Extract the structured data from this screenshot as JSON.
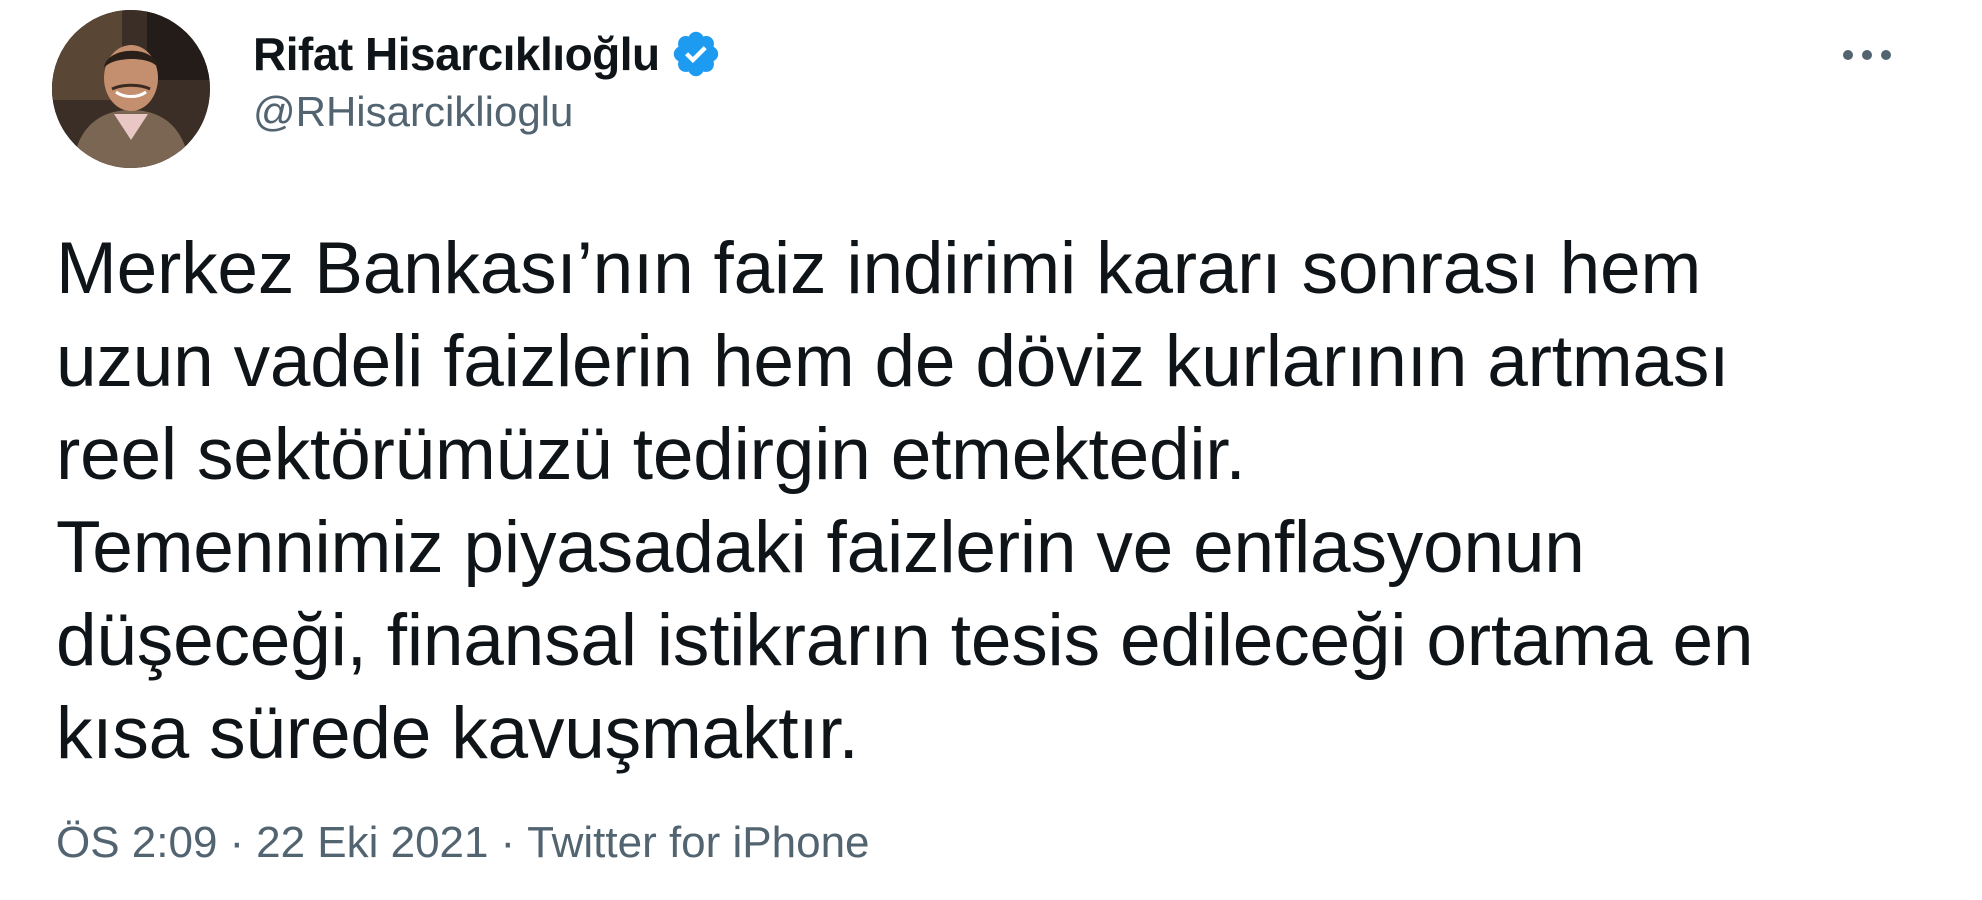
{
  "author": {
    "display_name": "Rifat Hisarcıklıoğlu",
    "handle": "@RHisarciklioglu",
    "verified": true
  },
  "icons": {
    "verified": "verified-badge-icon",
    "more": "more-options-icon",
    "verified_color": "#1d9bf0"
  },
  "tweet": {
    "lines": [
      "Merkez Bankası’nın faiz indirimi kararı sonrası hem",
      "uzun vadeli faizlerin hem de döviz kurlarının artması",
      "reel sektörümüzü tedirgin etmektedir.",
      "Temennimiz piyasadaki faizlerin ve enflasyonun",
      "düşeceği, finansal istikrarın tesis edileceği ortama en",
      "kısa sürede kavuşmaktır."
    ]
  },
  "meta": {
    "time": "ÖS 2:09",
    "separator": "·",
    "date": "22 Eki 2021",
    "source": "Twitter for iPhone"
  }
}
